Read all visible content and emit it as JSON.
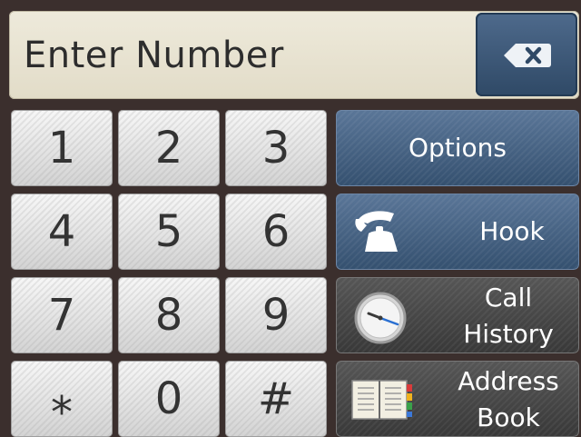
{
  "display": {
    "text": "Enter Number"
  },
  "backspace": {
    "icon": "backspace-icon"
  },
  "keypad": {
    "keys": [
      "1",
      "2",
      "3",
      "4",
      "5",
      "6",
      "7",
      "8",
      "9",
      "⁎",
      "0",
      "#"
    ]
  },
  "functions": {
    "options": {
      "label": "Options"
    },
    "hook": {
      "label": "Hook",
      "icon": "phone-handset-icon"
    },
    "call_history": {
      "line1": "Call",
      "line2": "History",
      "icon": "clock-icon"
    },
    "address_book": {
      "line1": "Address",
      "line2": "Book",
      "icon": "address-book-icon"
    }
  },
  "colors": {
    "bezel": "#3b2f2d",
    "display_bg": "#e9e4d2",
    "blue_button": "#45607f",
    "dark_button": "#474747"
  }
}
